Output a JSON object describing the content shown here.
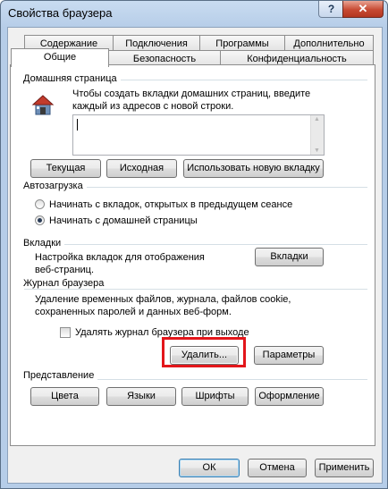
{
  "window": {
    "title": "Свойства браузера",
    "help_glyph": "?",
    "close_glyph": "✕"
  },
  "tabs": {
    "row1": [
      "Содержание",
      "Подключения",
      "Программы",
      "Дополнительно"
    ],
    "row2": [
      "Общие",
      "Безопасность",
      "Конфиденциальность"
    ],
    "active": "Общие"
  },
  "home": {
    "group_title": "Домашняя страница",
    "instruction": "Чтобы создать вкладки домашних страниц, введите каждый из адресов с новой строки.",
    "textarea_value": "",
    "buttons": [
      "Текущая",
      "Исходная",
      "Использовать новую вкладку"
    ]
  },
  "startup": {
    "group_title": "Автозагрузка",
    "options": [
      {
        "label": "Начинать с вкладок, открытых в предыдущем сеансе",
        "selected": false
      },
      {
        "label": "Начинать с домашней страницы",
        "selected": true
      }
    ]
  },
  "tabs_group": {
    "group_title": "Вкладки",
    "description": "Настройка вкладок для отображения веб-страниц.",
    "button": "Вкладки"
  },
  "history": {
    "group_title": "Журнал браузера",
    "description": "Удаление временных файлов, журнала, файлов cookie, сохраненных паролей и данных веб-форм.",
    "checkbox_label": "Удалять журнал браузера при выходе",
    "checkbox_checked": false,
    "delete_button": "Удалить...",
    "settings_button": "Параметры"
  },
  "appearance": {
    "group_title": "Представление",
    "buttons": [
      "Цвета",
      "Языки",
      "Шрифты",
      "Оформление"
    ]
  },
  "footer": {
    "ok": "ОК",
    "cancel": "Отмена",
    "apply": "Применить"
  },
  "colors": {
    "highlight": "#e3161b",
    "title_bar": "#b6cde8",
    "close_button": "#c74a33"
  }
}
